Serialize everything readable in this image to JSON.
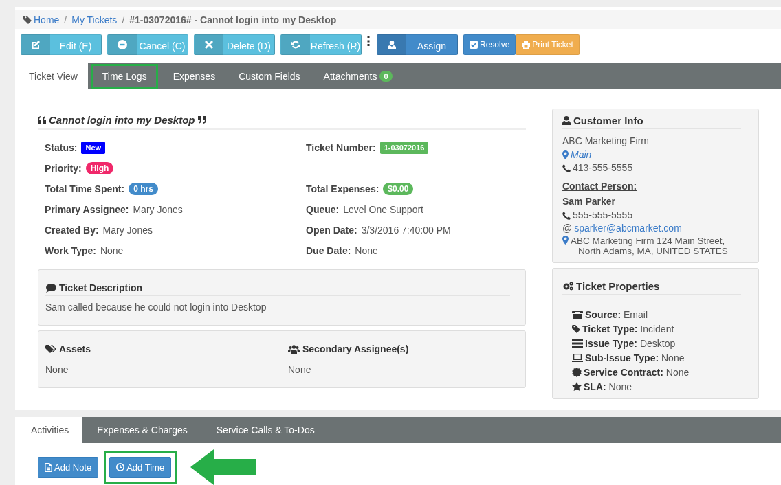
{
  "breadcrumb": [
    {
      "label": "Home",
      "kind": "link"
    },
    {
      "separator": "/",
      "label": "My Tickets",
      "kind": "link"
    },
    {
      "separator": "/",
      "label": "#1-03072016# - Cannot login into my Desktop",
      "kind": "current"
    }
  ],
  "toolbar": [
    {
      "label": "Edit (E)",
      "kind": "split",
      "color": "#5bc0de"
    },
    {
      "label": "Cancel (C)",
      "kind": "split",
      "color": "#5bc0de"
    },
    {
      "label": "Delete (D)",
      "kind": "split",
      "color": "#5bc0de"
    },
    {
      "label": "Refresh (R)",
      "kind": "split",
      "color": "#5bc0de"
    },
    {
      "kind": "dots"
    },
    {
      "label": "Assign",
      "kind": "split",
      "color": "#428bca"
    },
    {
      "label": "Resolve",
      "kind": "compact",
      "color": "#428bca"
    },
    {
      "label": "Print Ticket",
      "kind": "compact",
      "color": "#f0ad4e"
    }
  ],
  "tabs": [
    {
      "label": "Ticket View",
      "selected": true,
      "highlighted": false
    },
    {
      "label": "Time Logs",
      "selected": false,
      "highlighted": true
    },
    {
      "label": "Expenses",
      "selected": false,
      "highlighted": false
    },
    {
      "label": "Custom Fields",
      "selected": false,
      "highlighted": false
    },
    {
      "label": "Attachments",
      "selected": false,
      "highlighted": false,
      "badge": "0"
    }
  ],
  "ticket": {
    "title": "Cannot login into my Desktop",
    "rows": [
      {
        "cells": [
          {
            "label": "Status:",
            "value": "New",
            "kind": "tag",
            "color": "#0000ff"
          },
          {
            "label": "Ticket Number:",
            "value": "1-03072016",
            "kind": "tag",
            "color": "#5cb85c"
          }
        ]
      },
      {
        "cells": [
          {
            "label": "Priority:",
            "value": "High",
            "kind": "pill",
            "color": "#f0286a"
          }
        ]
      },
      {
        "cells": [
          {
            "label": "Total Time Spent:",
            "value": "0 hrs",
            "kind": "pill",
            "color": "#428bca"
          },
          {
            "label": "Total Expenses:",
            "value": "$0.00",
            "kind": "pill",
            "color": "#5cb85c"
          }
        ]
      },
      {
        "cells": [
          {
            "label": "Primary Assignee:",
            "value": "Mary Jones",
            "kind": "text"
          },
          {
            "label": "Queue:",
            "value": "Level One Support",
            "kind": "text"
          }
        ]
      },
      {
        "cells": [
          {
            "label": "Created By:",
            "value": "Mary Jones",
            "kind": "text"
          },
          {
            "label": "Open Date:",
            "value": "3/3/2016 7:40:00 PM",
            "kind": "text"
          }
        ]
      },
      {
        "cells": [
          {
            "label": "Work Type:",
            "value": "None",
            "kind": "text"
          },
          {
            "label": "Due Date:",
            "value": "None",
            "kind": "text"
          }
        ]
      }
    ]
  },
  "description": {
    "title": "Ticket Description",
    "text": "Sam called because he could not login into Desktop"
  },
  "assets": {
    "title": "Assets",
    "text": "None"
  },
  "secondary_assignees": {
    "title": "Secondary Assignee(s)",
    "text": "None"
  },
  "customer_info": {
    "title": "Customer Info",
    "company": "ABC Marketing Firm",
    "location": "Main",
    "phone": "413-555-5555",
    "contact_heading": "Contact Person:",
    "contact_name": "Sam Parker",
    "contact_phone": "555-555-5555",
    "email_prefix": "@",
    "contact_email": "sparker@abcmarket.com",
    "address_lines": [
      "ABC Marketing Firm 124 Main Street,",
      "North Adams, MA, UNITED STATES"
    ]
  },
  "ticket_properties": {
    "title": "Ticket Properties",
    "items": [
      {
        "label": "Source:",
        "value": "Email"
      },
      {
        "label": "Ticket Type:",
        "value": "Incident"
      },
      {
        "label": "Issue Type:",
        "value": "Desktop"
      },
      {
        "label": "Sub-Issue Type:",
        "value": "None"
      },
      {
        "label": "Service Contract:",
        "value": "None"
      },
      {
        "label": "SLA:",
        "value": "None"
      }
    ]
  },
  "activity_tabs": [
    {
      "label": "Activities",
      "selected": true
    },
    {
      "label": "Expenses & Charges",
      "selected": false
    },
    {
      "label": "Service Calls & To-Dos",
      "selected": false
    }
  ],
  "activity_buttons": [
    {
      "label": "Add Note",
      "highlighted": false
    },
    {
      "label": "Add Time",
      "highlighted": true
    }
  ]
}
